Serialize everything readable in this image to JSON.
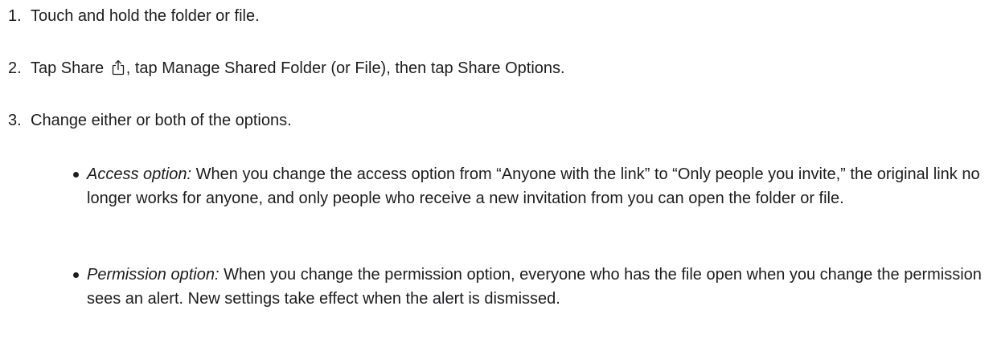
{
  "steps": [
    {
      "number": "1.",
      "text": "Touch and hold the folder or file."
    },
    {
      "number": "2.",
      "text_before_icon": "Tap Share ",
      "icon": "share-icon",
      "text_after_icon": ", tap Manage Shared Folder (or File), then tap Share Options."
    },
    {
      "number": "3.",
      "text": "Change either or both of the options."
    }
  ],
  "options": [
    {
      "label": "Access option:",
      "text": " When you change the access option from “Anyone with the link” to “Only people you invite,” the original link no longer works for anyone, and only people who receive a new invitation from you can open the folder or file."
    },
    {
      "label": "Permission option:",
      "text": " When you change the permission option, everyone who has the file open when you change the permission sees an alert. New settings take effect when the alert is dismissed."
    }
  ],
  "colors": {
    "text": "#1d1d1f",
    "background": "#ffffff"
  }
}
